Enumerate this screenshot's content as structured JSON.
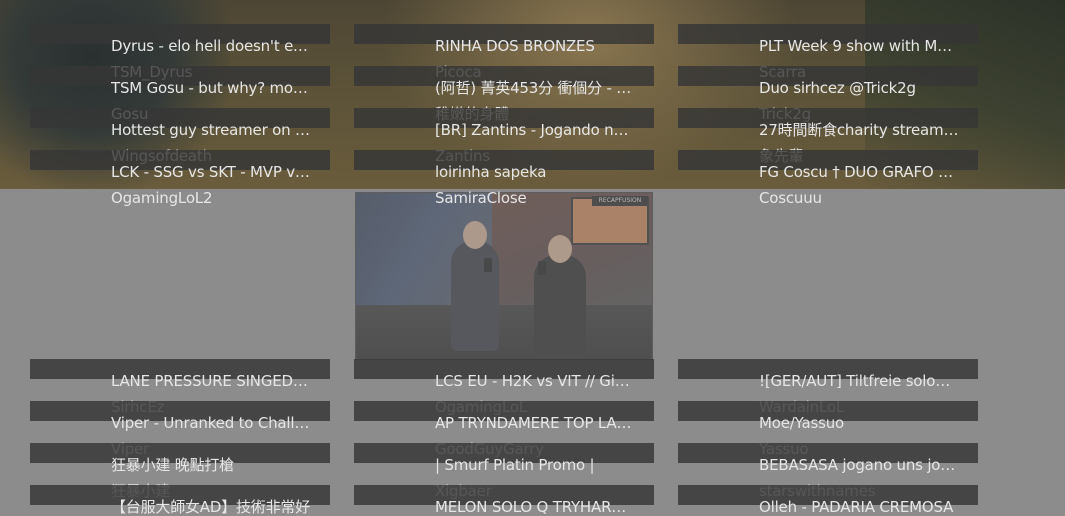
{
  "cells": [
    {
      "title": "Dyrus - elo hell doesn't exist",
      "name": "TSM_Dyrus"
    },
    {
      "title": "RINHA DOS BRONZES",
      "name": "Picoca"
    },
    {
      "title": "PLT Week 9 show with MonteCristo",
      "name": "Scarra"
    },
    {
      "title": "TSM Gosu - but why? more like",
      "name": "Gosu"
    },
    {
      "title": "(阿哲) 菁英453分 衝個分 - mid",
      "name": "稚嫩的身體"
    },
    {
      "title": "Duo sirhcez @Trick2g",
      "name": "Trick2g"
    },
    {
      "title": "Hottest guy streamer on twitch",
      "name": "Wingsofdeath"
    },
    {
      "title": "[BR] Zantins - Jogando na madrugada",
      "name": "Zantins"
    },
    {
      "title": "27時間断食charity stream day",
      "name": "象先輩"
    },
    {
      "title": "LCK - SSG vs SKT - MVP vs SKT",
      "name": "OgamingLoL2"
    },
    {
      "title": "loirinha sapeka",
      "name": "SamiraClose"
    },
    {
      "title": "FG Coscu † DUO GRAFO † LAS",
      "name": "Coscuuu"
    },
    {
      "title": "LANE PRESSURE SINGED - Diamond",
      "name": "SirhcEz"
    },
    {
      "title": "LCS EU - H2K vs VIT // Giants vs",
      "name": "OgamingLoL"
    },
    {
      "title": "![GER/AUT] Tiltfreie soloQ mit",
      "name": "WardainLoL"
    },
    {
      "title": "Viper - Unranked to Challenger",
      "name": "Viper"
    },
    {
      "title": "AP TRYNDAMERE TOP LANE - 1v9",
      "name": "GoodGuyGarry"
    },
    {
      "title": "Moe/Yassuo",
      "name": "Yassuo"
    },
    {
      "title": "狂暴小建 晚點打槍",
      "name": "狂暴小建"
    },
    {
      "title": "| Smurf Platin Promo |",
      "name": "Xigbaer"
    },
    {
      "title": "BEBASASA jogano uns jogos",
      "name": "starswithnames"
    },
    {
      "title": "【台服大師女AD】技術非常好",
      "name": ""
    },
    {
      "title": "MELON SOLO Q TRYHARD MODE ON",
      "name": ""
    },
    {
      "title": "Olleh - PADARIA CREMOSA",
      "name": ""
    }
  ],
  "player": {
    "badge": "RECAPFUSION"
  }
}
